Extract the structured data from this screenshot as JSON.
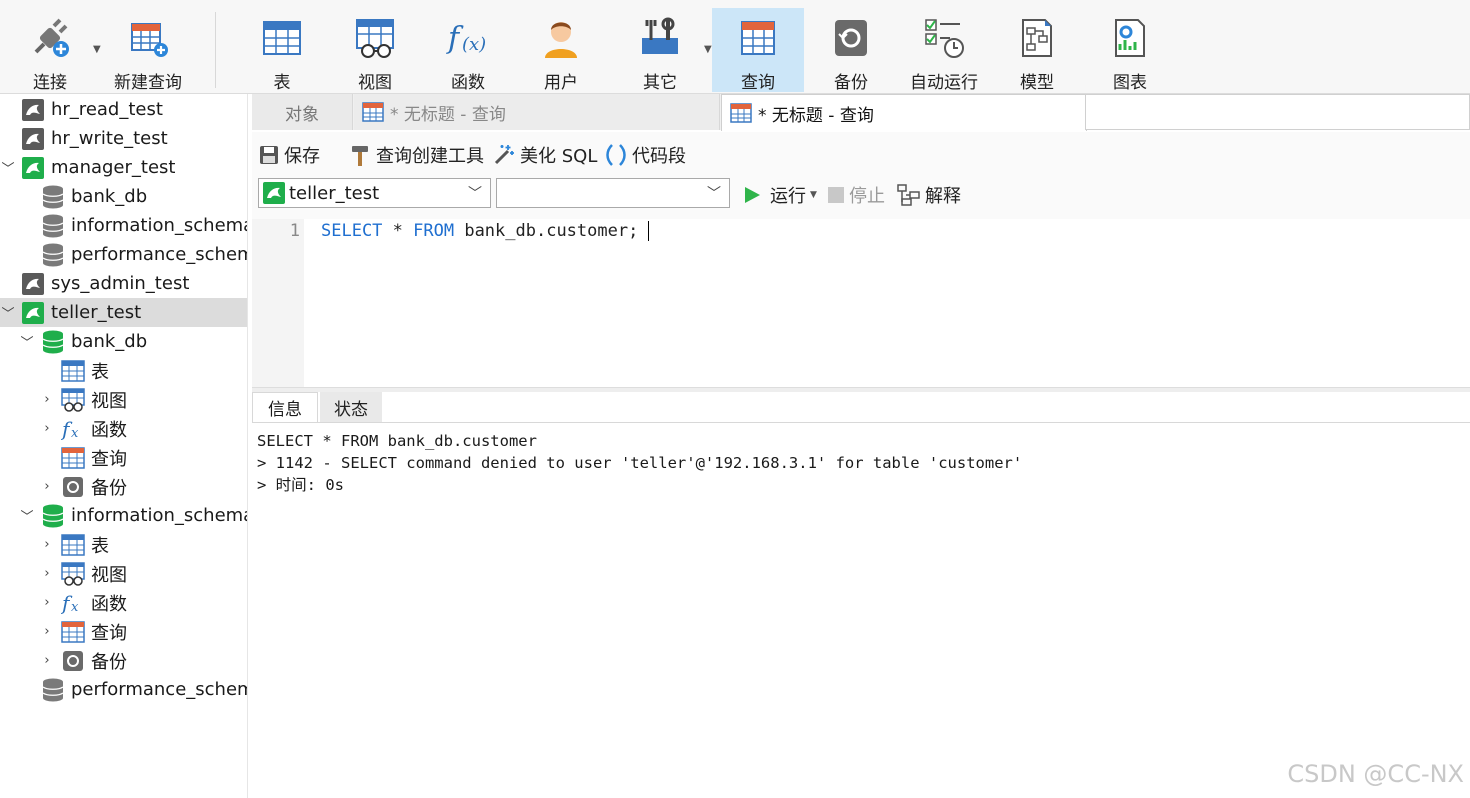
{
  "toolbar": {
    "connect": "连接",
    "new_query": "新建查询",
    "table": "表",
    "view": "视图",
    "function": "函数",
    "user": "用户",
    "other": "其它",
    "query": "查询",
    "backup": "备份",
    "auto_run": "自动运行",
    "model": "模型",
    "chart": "图表"
  },
  "tree": {
    "items": [
      {
        "label": "hr_read_test"
      },
      {
        "label": "hr_write_test"
      },
      {
        "label": "manager_test"
      },
      {
        "label": "bank_db"
      },
      {
        "label": "information_schema"
      },
      {
        "label": "performance_schema"
      },
      {
        "label": "sys_admin_test"
      },
      {
        "label": "teller_test"
      },
      {
        "label": "bank_db"
      },
      {
        "label": "表"
      },
      {
        "label": "视图"
      },
      {
        "label": "函数"
      },
      {
        "label": "查询"
      },
      {
        "label": "备份"
      },
      {
        "label": "information_schema"
      },
      {
        "label": "表"
      },
      {
        "label": "视图"
      },
      {
        "label": "函数"
      },
      {
        "label": "查询"
      },
      {
        "label": "备份"
      },
      {
        "label": "performance_schema"
      }
    ]
  },
  "tabs": {
    "objects": "对象",
    "query1": "* 无标题 - 查询",
    "query2": "* 无标题 - 查询"
  },
  "query_toolbar": {
    "save": "保存",
    "builder": "查询创建工具",
    "beautify": "美化 SQL",
    "snippet": "代码段",
    "connection": "teller_test",
    "database": "",
    "run": "运行",
    "stop": "停止",
    "explain": "解释"
  },
  "editor": {
    "line_number": "1",
    "kw_select": "SELECT",
    "star": " * ",
    "kw_from": "FROM",
    "rest": " bank_db.customer;"
  },
  "results": {
    "tab_info": "信息",
    "tab_status": "状态",
    "lines": [
      "SELECT * FROM bank_db.customer",
      "> 1142 - SELECT command denied to user 'teller'@'192.168.3.1' for table 'customer'",
      "> 时间: 0s"
    ]
  },
  "watermark": "CSDN @CC-NX",
  "colors": {
    "active_tab_bg": "#cce6f8",
    "keyword": "#1f6fd0",
    "mysql_green": "#1fae4b",
    "mysql_gray": "#5a5a5a",
    "run_green": "#2fb44a"
  }
}
